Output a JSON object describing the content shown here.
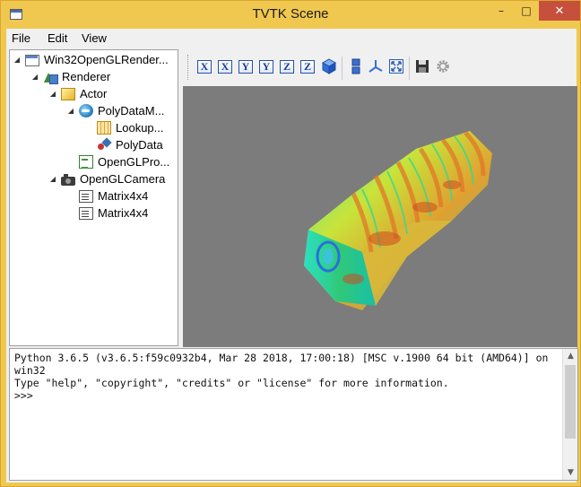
{
  "window": {
    "title": "TVTK Scene"
  },
  "menu": [
    {
      "label": "File"
    },
    {
      "label": "Edit"
    },
    {
      "label": "View"
    }
  ],
  "tree": [
    {
      "label": "Win32OpenGLRender...",
      "icon": "window-icon",
      "expanded": true
    },
    {
      "label": "Renderer",
      "icon": "renderer-icon",
      "expanded": true
    },
    {
      "label": "Actor",
      "icon": "actor-icon",
      "expanded": true
    },
    {
      "label": "PolyDataM...",
      "icon": "mapper-icon",
      "expanded": true
    },
    {
      "label": "Lookup...",
      "icon": "lookup-table-icon"
    },
    {
      "label": "PolyData",
      "icon": "polydata-icon"
    },
    {
      "label": "OpenGLPro...",
      "icon": "property-icon"
    },
    {
      "label": "OpenGLCamera",
      "icon": "camera-icon",
      "expanded": true
    },
    {
      "label": "Matrix4x4",
      "icon": "matrix-icon"
    },
    {
      "label": "Matrix4x4",
      "icon": "matrix-icon"
    }
  ],
  "toolbar": {
    "view_buttons": [
      {
        "label": "X",
        "name": "view-plus-x-button"
      },
      {
        "label": "X",
        "name": "view-minus-x-button"
      },
      {
        "label": "Y",
        "name": "view-plus-y-button"
      },
      {
        "label": "Y",
        "name": "view-minus-y-button"
      },
      {
        "label": "Z",
        "name": "view-plus-z-button"
      },
      {
        "label": "Z",
        "name": "view-minus-z-button"
      }
    ],
    "icons": [
      "isometric-cube-icon",
      "parallel-projection-icon",
      "axes-icon",
      "fullscreen-icon",
      "save-icon",
      "settings-icon"
    ]
  },
  "console": {
    "text": "Python 3.6.5 (v3.6.5:f59c0932b4, Mar 28 2018, 17:00:18) [MSC v.1900 64 bit (AMD64)] on win32\nType \"help\", \"copyright\", \"credits\" or \"license\" for more information.\n>>> "
  },
  "colors": {
    "titlebar": "#f0c850",
    "close_button": "#c7503c",
    "viewport_bg": "#7c7c7c"
  }
}
